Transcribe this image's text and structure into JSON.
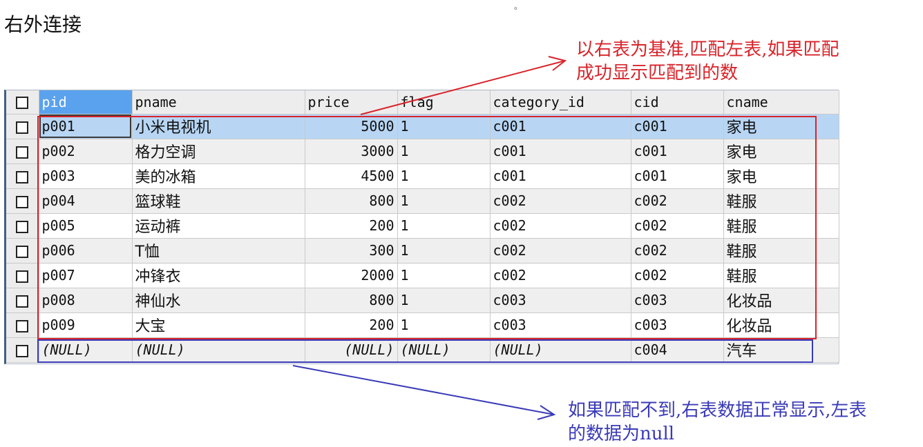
{
  "page": {
    "title": "右外连接",
    "dot": "。"
  },
  "notes": {
    "red": [
      "以右表为基准,匹配左表,如果匹配",
      "成功显示匹配到的数"
    ],
    "blue": [
      "如果匹配不到,右表数据正常显示,左表",
      "的数据为null"
    ]
  },
  "colors": {
    "red_annotation": "#d8232a",
    "blue_annotation": "#3a3ab8",
    "sorted_header": "#5aa2ee",
    "selected_row": "#b8d6f4"
  },
  "grid": {
    "columns": [
      "pid",
      "pname",
      "price",
      "flag",
      "category_id",
      "cid",
      "cname"
    ],
    "rows": [
      [
        "p001",
        "小米电视机",
        "5000",
        "1",
        "c001",
        "c001",
        "家电"
      ],
      [
        "p002",
        "格力空调",
        "3000",
        "1",
        "c001",
        "c001",
        "家电"
      ],
      [
        "p003",
        "美的冰箱",
        "4500",
        "1",
        "c001",
        "c001",
        "家电"
      ],
      [
        "p004",
        "篮球鞋",
        "800",
        "1",
        "c002",
        "c002",
        "鞋服"
      ],
      [
        "p005",
        "运动裤",
        "200",
        "1",
        "c002",
        "c002",
        "鞋服"
      ],
      [
        "p006",
        "T恤",
        "300",
        "1",
        "c002",
        "c002",
        "鞋服"
      ],
      [
        "p007",
        "冲锋衣",
        "2000",
        "1",
        "c002",
        "c002",
        "鞋服"
      ],
      [
        "p008",
        "神仙水",
        "800",
        "1",
        "c003",
        "c003",
        "化妆品"
      ],
      [
        "p009",
        "大宝",
        "200",
        "1",
        "c003",
        "c003",
        "化妆品"
      ],
      [
        "(NULL)",
        "(NULL)",
        "(NULL)",
        "(NULL)",
        "(NULL)",
        "c004",
        "汽车"
      ]
    ]
  }
}
